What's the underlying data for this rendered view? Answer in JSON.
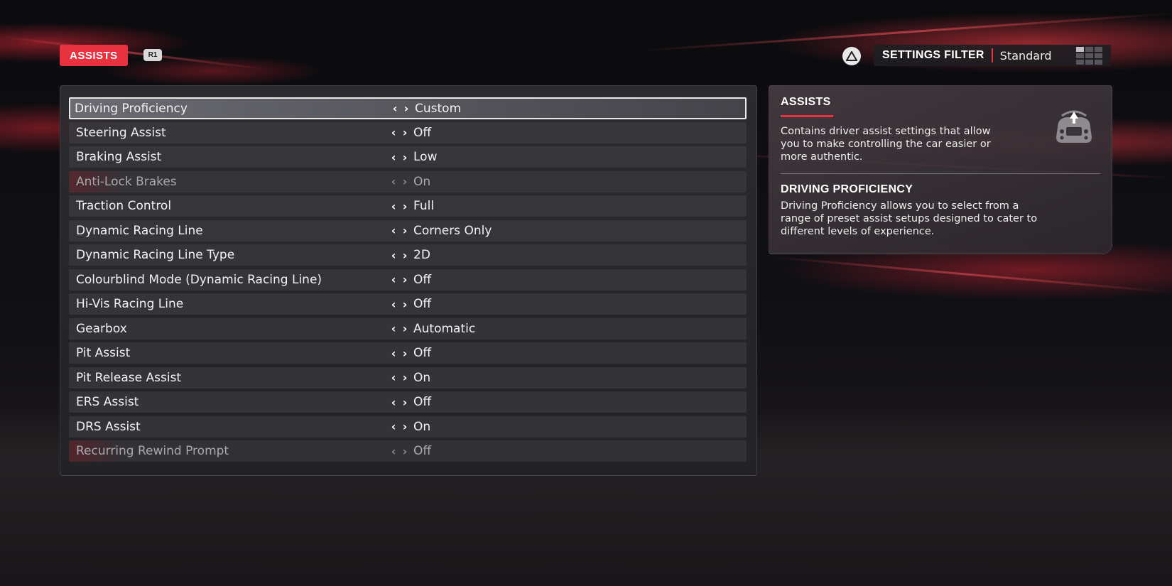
{
  "header": {
    "tab_label": "ASSISTS",
    "r1_label": "R1",
    "filter_label": "SETTINGS FILTER",
    "filter_value": "Standard"
  },
  "settings": [
    {
      "label": "Driving Proficiency",
      "value": "Custom",
      "selected": true,
      "disabled": false
    },
    {
      "label": "Steering Assist",
      "value": "Off",
      "selected": false,
      "disabled": false
    },
    {
      "label": "Braking Assist",
      "value": "Low",
      "selected": false,
      "disabled": false
    },
    {
      "label": "Anti-Lock Brakes",
      "value": "On",
      "selected": false,
      "disabled": true
    },
    {
      "label": "Traction Control",
      "value": "Full",
      "selected": false,
      "disabled": false
    },
    {
      "label": "Dynamic Racing Line",
      "value": "Corners Only",
      "selected": false,
      "disabled": false
    },
    {
      "label": "Dynamic Racing Line Type",
      "value": "2D",
      "selected": false,
      "disabled": false
    },
    {
      "label": "Colourblind Mode (Dynamic Racing Line)",
      "value": "Off",
      "selected": false,
      "disabled": false
    },
    {
      "label": "Hi-Vis Racing Line",
      "value": "Off",
      "selected": false,
      "disabled": false
    },
    {
      "label": "Gearbox",
      "value": "Automatic",
      "selected": false,
      "disabled": false
    },
    {
      "label": "Pit Assist",
      "value": "Off",
      "selected": false,
      "disabled": false
    },
    {
      "label": "Pit Release Assist",
      "value": "On",
      "selected": false,
      "disabled": false
    },
    {
      "label": "ERS Assist",
      "value": "Off",
      "selected": false,
      "disabled": false
    },
    {
      "label": "DRS Assist",
      "value": "On",
      "selected": false,
      "disabled": false
    },
    {
      "label": "Recurring Rewind Prompt",
      "value": "Off",
      "selected": false,
      "disabled": true
    }
  ],
  "info": {
    "section_title": "ASSISTS",
    "section_text_1": "Contains driver assist settings that allow",
    "section_text_2": "you to make controlling the car easier or",
    "section_text_3": "more authentic.",
    "item_title": "DRIVING PROFICIENCY",
    "item_text_1": "Driving Proficiency allows you to select from a",
    "item_text_2": "range of preset assist setups designed to cater to",
    "item_text_3": "different levels of experience."
  },
  "colors": {
    "accent": "#e8323f"
  },
  "icons": {
    "triangle": "triangle-button-icon",
    "wheel": "steering-wheel-icon",
    "filter": "filter-grid-icon"
  }
}
